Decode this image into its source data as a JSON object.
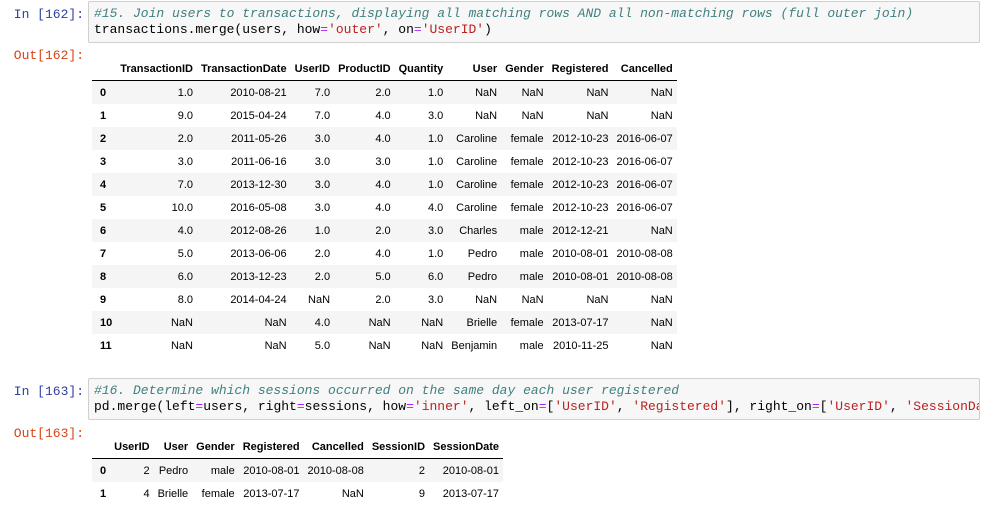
{
  "cells": [
    {
      "in_prompt": "In [162]:",
      "out_prompt": "Out[162]:",
      "code_comment": "#15. Join users to transactions, displaying all matching rows AND all non-matching rows (full outer join)",
      "code_tokens": [
        "transactions.merge(users, how",
        "=",
        "'outer'",
        ", on",
        "=",
        "'UserID'",
        ")"
      ],
      "table": {
        "columns": [
          "TransactionID",
          "TransactionDate",
          "UserID",
          "ProductID",
          "Quantity",
          "User",
          "Gender",
          "Registered",
          "Cancelled"
        ],
        "rows": [
          [
            "0",
            "1.0",
            "2010-08-21",
            "7.0",
            "2.0",
            "1.0",
            "NaN",
            "NaN",
            "NaN",
            "NaN"
          ],
          [
            "1",
            "9.0",
            "2015-04-24",
            "7.0",
            "4.0",
            "3.0",
            "NaN",
            "NaN",
            "NaN",
            "NaN"
          ],
          [
            "2",
            "2.0",
            "2011-05-26",
            "3.0",
            "4.0",
            "1.0",
            "Caroline",
            "female",
            "2012-10-23",
            "2016-06-07"
          ],
          [
            "3",
            "3.0",
            "2011-06-16",
            "3.0",
            "3.0",
            "1.0",
            "Caroline",
            "female",
            "2012-10-23",
            "2016-06-07"
          ],
          [
            "4",
            "7.0",
            "2013-12-30",
            "3.0",
            "4.0",
            "1.0",
            "Caroline",
            "female",
            "2012-10-23",
            "2016-06-07"
          ],
          [
            "5",
            "10.0",
            "2016-05-08",
            "3.0",
            "4.0",
            "4.0",
            "Caroline",
            "female",
            "2012-10-23",
            "2016-06-07"
          ],
          [
            "6",
            "4.0",
            "2012-08-26",
            "1.0",
            "2.0",
            "3.0",
            "Charles",
            "male",
            "2012-12-21",
            "NaN"
          ],
          [
            "7",
            "5.0",
            "2013-06-06",
            "2.0",
            "4.0",
            "1.0",
            "Pedro",
            "male",
            "2010-08-01",
            "2010-08-08"
          ],
          [
            "8",
            "6.0",
            "2013-12-23",
            "2.0",
            "5.0",
            "6.0",
            "Pedro",
            "male",
            "2010-08-01",
            "2010-08-08"
          ],
          [
            "9",
            "8.0",
            "2014-04-24",
            "NaN",
            "2.0",
            "3.0",
            "NaN",
            "NaN",
            "NaN",
            "NaN"
          ],
          [
            "10",
            "NaN",
            "NaN",
            "4.0",
            "NaN",
            "NaN",
            "Brielle",
            "female",
            "2013-07-17",
            "NaN"
          ],
          [
            "11",
            "NaN",
            "NaN",
            "5.0",
            "NaN",
            "NaN",
            "Benjamin",
            "male",
            "2010-11-25",
            "NaN"
          ]
        ]
      }
    },
    {
      "in_prompt": "In [163]:",
      "out_prompt": "Out[163]:",
      "code_comment": "#16. Determine which sessions occurred on the same day each user registered",
      "code_tokens": [
        "pd.merge(left",
        "=",
        "users, right",
        "=",
        "sessions, how",
        "=",
        "'inner'",
        ", left_on",
        "=",
        "[",
        "'UserID'",
        ", ",
        "'Registered'",
        "], right_on",
        "=",
        "[",
        "'UserID'",
        ", ",
        "'SessionDate'",
        "])"
      ],
      "table": {
        "columns": [
          "UserID",
          "User",
          "Gender",
          "Registered",
          "Cancelled",
          "SessionID",
          "SessionDate"
        ],
        "rows": [
          [
            "0",
            "2",
            "Pedro",
            "male",
            "2010-08-01",
            "2010-08-08",
            "2",
            "2010-08-01"
          ],
          [
            "1",
            "4",
            "Brielle",
            "female",
            "2013-07-17",
            "NaN",
            "9",
            "2013-07-17"
          ]
        ]
      }
    }
  ]
}
